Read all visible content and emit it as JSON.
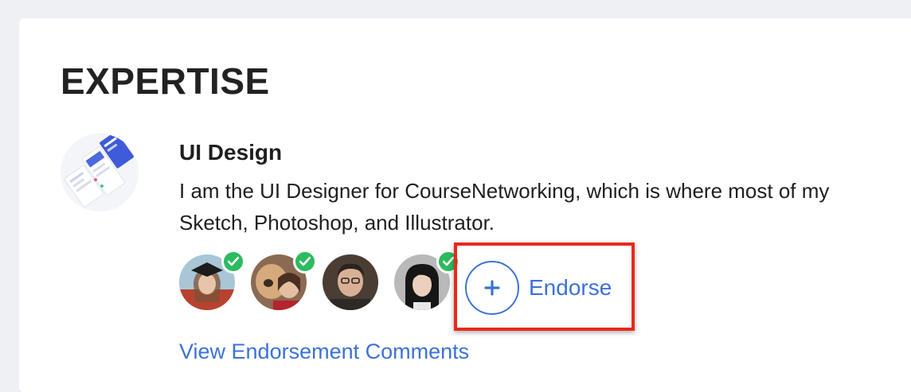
{
  "section": {
    "title": "EXPERTISE"
  },
  "skill": {
    "name": "UI Design",
    "description_line1": "I am the UI Designer for CourseNetworking, which is where most of my",
    "description_line2": "Sketch, Photoshop, and Illustrator.",
    "thumbnail_icon": "design-mockup-thumbnail"
  },
  "endorsers": [
    {
      "name": "endorser-graduate",
      "verified": true,
      "palette": [
        "#8fb3c7",
        "#d8b49a",
        "#5b3b2a"
      ]
    },
    {
      "name": "endorser-with-dog",
      "verified": true,
      "palette": [
        "#c9a27a",
        "#e0c3a0",
        "#7a4b3a"
      ]
    },
    {
      "name": "endorser-man",
      "verified": false,
      "palette": [
        "#6b5a4a",
        "#e0b9a0",
        "#2b2420"
      ]
    },
    {
      "name": "endorser-woman",
      "verified": true,
      "palette": [
        "#a9a9a9",
        "#e8cbb8",
        "#1c1c1c"
      ]
    }
  ],
  "actions": {
    "endorse_label": "Endorse",
    "view_comments_label": "View Endorsement Comments"
  },
  "colors": {
    "accent": "#3c72d6",
    "verified": "#2dbb5f",
    "highlight": "#e8281d"
  }
}
